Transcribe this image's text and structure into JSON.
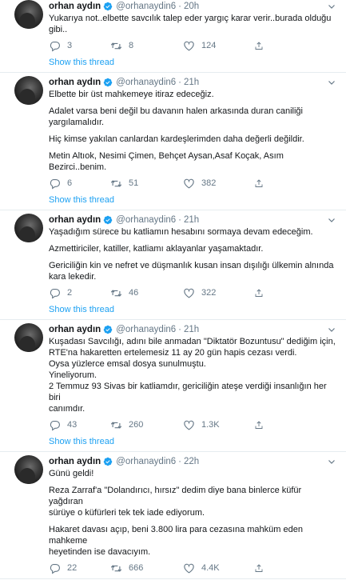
{
  "user": {
    "name": "orhan aydın",
    "handle": "@orhanaydin6",
    "verified_icon": "verified-badge-icon",
    "accent": "#1da1f2"
  },
  "show_thread_label": "Show this thread",
  "tweets": [
    {
      "time": "20h",
      "paragraphs": [
        [
          "Yukarıya not..elbette savcılık talep eder yargıç karar verir..burada olduğu",
          "gibi.."
        ]
      ],
      "replies": "3",
      "retweets": "8",
      "likes": "124",
      "show_thread": true
    },
    {
      "time": "21h",
      "paragraphs": [
        [
          "Elbette bir üst mahkemeye itiraz edeceğiz."
        ],
        [
          "Adalet varsa beni değil bu davanın halen arkasında duran caniliği",
          "yargılamalıdır."
        ],
        [
          "Hiç kimse yakılan canlardan kardeşlerimden daha değerli değildir."
        ],
        [
          "Metin Altıok, Nesimi Çimen, Behçet Aysan,Asaf Koçak, Asım Bezirci..benim."
        ]
      ],
      "replies": "6",
      "retweets": "51",
      "likes": "382",
      "show_thread": true
    },
    {
      "time": "21h",
      "paragraphs": [
        [
          "Yaşadığım sürece bu katliamın hesabını sormaya devam edeceğim."
        ],
        [
          "Azmettiriciler, katiller, katliamı aklayanlar yaşamaktadır."
        ],
        [
          "Gericiliğin kin ve nefret ve düşmanlık kusan insan dışılığı ülkemin alnında",
          "kara lekedir."
        ]
      ],
      "replies": "2",
      "retweets": "46",
      "likes": "322",
      "show_thread": true
    },
    {
      "time": "21h",
      "paragraphs": [
        [
          "Kuşadası Savcılığı, adını bile anmadan \"Diktatör Bozuntusu\" dediğim için,",
          "RTE'na hakaretten ertelemesiz 11 ay 20 gün hapis cezası verdi.",
          "Oysa yüzlerce emsal dosya sunulmuştu.",
          "Yineliyorum.",
          "2 Temmuz 93 Sivas bir katliamdır, gericiliğin ateşe verdiği insanlığın her biri",
          "canımdır."
        ]
      ],
      "replies": "43",
      "retweets": "260",
      "likes": "1.3K",
      "show_thread": true
    },
    {
      "time": "22h",
      "paragraphs": [
        [
          "Günü geldi!"
        ],
        [
          "Reza Zarraf'a \"Dolandırıcı, hırsız\" dedim diye bana binlerce küfür yağdıran",
          "sürüye o küfürleri tek tek iade ediyorum."
        ],
        [
          "Hakaret davası açıp, beni 3.800 lira para cezasına mahküm eden mahkeme",
          "heyetinden ise davacıyım."
        ]
      ],
      "replies": "22",
      "retweets": "666",
      "likes": "4.4K",
      "show_thread": false
    }
  ],
  "icons": {
    "reply": "reply-icon",
    "retweet": "retweet-icon",
    "like": "like-icon",
    "share": "share-icon",
    "more": "chevron-down-icon"
  }
}
